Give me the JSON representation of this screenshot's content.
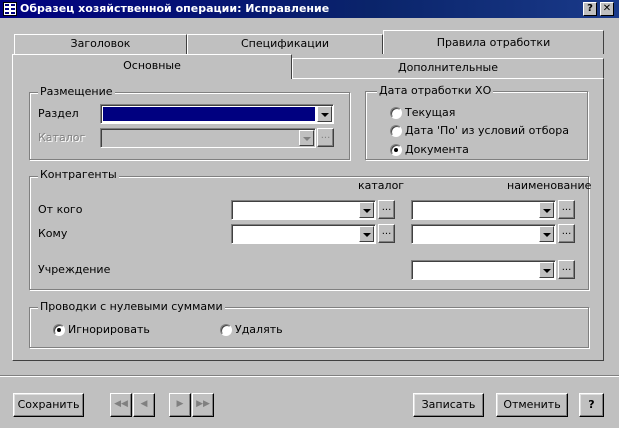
{
  "window": {
    "title": "Образец хозяйственной операции: Исправление",
    "help_glyph": "?",
    "close_glyph": "✕"
  },
  "tabs": {
    "top_row": [
      {
        "label": "Заголовок"
      },
      {
        "label": "Спецификации"
      },
      {
        "label": "Правила отработки"
      }
    ],
    "bottom_row": [
      {
        "label": "Основные"
      },
      {
        "label": "Дополнительные"
      }
    ]
  },
  "placement": {
    "legend": "Размещение",
    "section_label": "Раздел",
    "catalog_label": "Каталог",
    "ellipsis": "..."
  },
  "processing_date": {
    "legend": "Дата отработки ХО",
    "options": [
      {
        "label": "Текущая",
        "checked": false
      },
      {
        "label": "Дата 'По' из условий отбора",
        "checked": false
      },
      {
        "label": "Документа",
        "checked": true
      }
    ]
  },
  "counterparties": {
    "legend": "Контрагенты",
    "col_catalog": "каталог",
    "col_name": "наименование",
    "from_label": "От кого",
    "to_label": "Кому",
    "institution_label": "Учреждение",
    "ellipsis": "..."
  },
  "zero_postings": {
    "legend": "Проводки с нулевыми суммами",
    "options": [
      {
        "label": "Игнорировать",
        "checked": true
      },
      {
        "label": "Удалять",
        "checked": false
      }
    ]
  },
  "footer": {
    "save_label": "Сохранить",
    "nav_first": "◀◀",
    "nav_prev": "◀",
    "nav_next": "▶",
    "nav_last": "▶▶",
    "record_label": "Записать",
    "cancel_label": "Отменить",
    "help_label": "?"
  },
  "colors": {
    "titlebar": "#000080",
    "face": "#c0c0c0",
    "selection": "#000080"
  }
}
